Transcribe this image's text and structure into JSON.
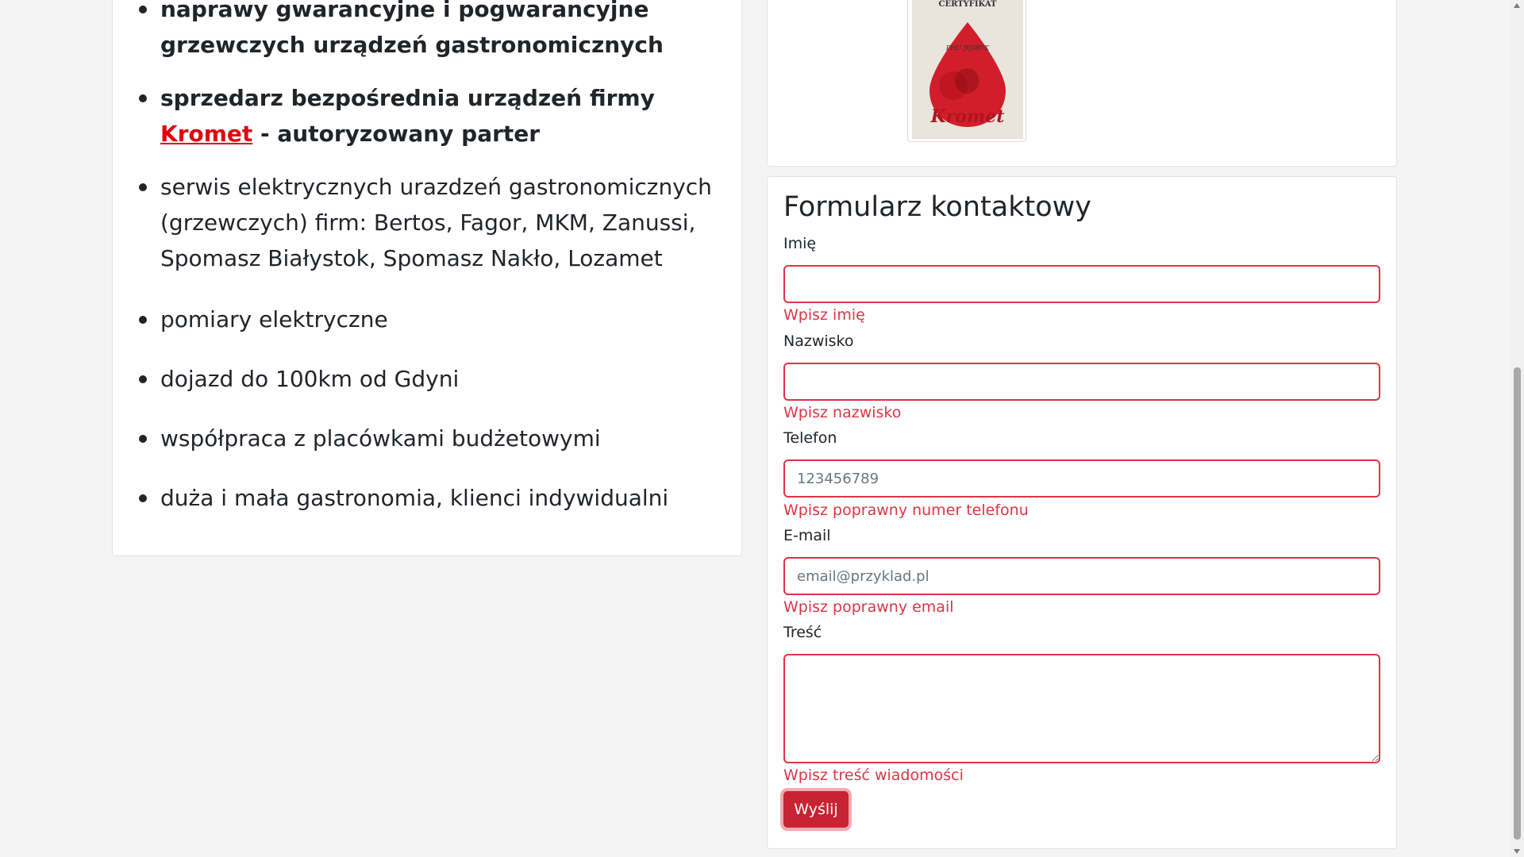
{
  "services": {
    "items": [
      {
        "text": "naprawy gwarancyjne i pogwarancyjne grzewczych urządzeń gastronomicznych"
      },
      {
        "prefix": "sprzedarz bezpośrednia urządzeń firmy ",
        "link": "Kromet",
        "suffix": " - autoryzowany parter"
      },
      {
        "text": "serwis elektrycznych urazdzeń gastronomicznych (grzewczych) firm: Bertos, Fagor, MKM, Zanussi, Spomasz Białystok, Spomasz Nakło, Lozamet"
      },
      {
        "text": "pomiary elektryczne"
      },
      {
        "text": "dojazd do 100km od Gdyni"
      },
      {
        "text": "współpraca z placówkami budżetowymi"
      },
      {
        "text": "duża i mała gastronomia, klienci indywidualni"
      }
    ]
  },
  "certificate": {
    "title": "CERTYFIKAT",
    "name": "PHU JĘDRYK",
    "brand": "Kromet"
  },
  "form": {
    "title": "Formularz kontaktowy",
    "first_name": {
      "label": "Imię",
      "value": "",
      "placeholder": "",
      "error": "Wpisz imię"
    },
    "last_name": {
      "label": "Nazwisko",
      "value": "",
      "placeholder": "",
      "error": "Wpisz nazwisko"
    },
    "phone": {
      "label": "Telefon",
      "value": "",
      "placeholder": "123456789",
      "error": "Wpisz poprawny numer telefonu"
    },
    "email": {
      "label": "E-mail",
      "value": "",
      "placeholder": "email@przyklad.pl",
      "error": "Wpisz poprawny email"
    },
    "message": {
      "label": "Treść",
      "value": "",
      "placeholder": "",
      "error": "Wpisz treść wiadomości"
    },
    "submit_label": "Wyślij"
  },
  "colors": {
    "error": "#dc3545",
    "submit_bg": "#c82333",
    "link": "#e3000f",
    "page_bg": "#f4f4f4"
  }
}
